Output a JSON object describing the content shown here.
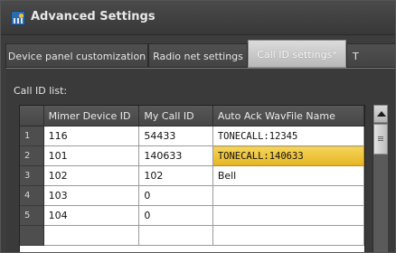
{
  "window": {
    "title": "Advanced Settings",
    "icon": "settings-window-icon"
  },
  "tabs": [
    {
      "label": "Device panel customization",
      "active": false
    },
    {
      "label": "Radio net settings",
      "active": false
    },
    {
      "label": "Call ID settings*",
      "active": true
    },
    {
      "label": "T",
      "active": false
    }
  ],
  "call_id_list": {
    "label": "Call ID list:",
    "columns": [
      "",
      "Mimer Device ID",
      "My Call ID",
      "Auto Ack WavFile Name"
    ],
    "rows": [
      {
        "num": "1",
        "device_id": "116",
        "call_id": "54433",
        "wavfile": "TONECALL:12345"
      },
      {
        "num": "2",
        "device_id": "101",
        "call_id": "140633",
        "wavfile": "TONECALL:140633"
      },
      {
        "num": "3",
        "device_id": "102",
        "call_id": "102",
        "wavfile": "Bell"
      },
      {
        "num": "4",
        "device_id": "103",
        "call_id": "0",
        "wavfile": ""
      },
      {
        "num": "5",
        "device_id": "104",
        "call_id": "0",
        "wavfile": ""
      },
      {
        "num": "",
        "device_id": "",
        "call_id": "",
        "wavfile": ""
      }
    ],
    "selected_cell": "row-2-wavfile",
    "highlight_color": "#f0c83a"
  }
}
